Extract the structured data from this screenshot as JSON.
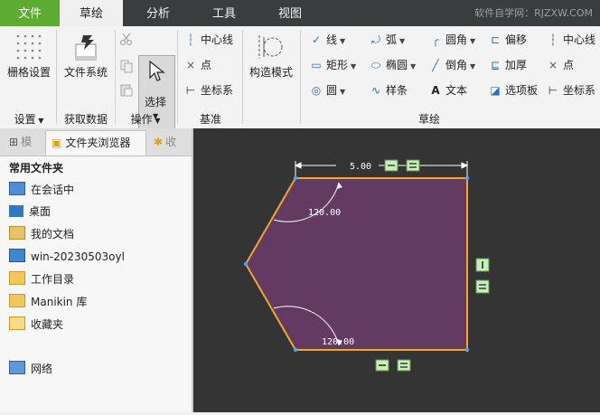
{
  "tabs": [
    "文件",
    "草绘",
    "分析",
    "工具",
    "视图"
  ],
  "watermark": "软件自学网：RJZXW.COM",
  "ribbon": {
    "grid_settings": "栅格设置",
    "settings_group": "设置",
    "file_system": "文件系统",
    "get_data_group": "获取数据",
    "select": "选择",
    "operations_group": "操作",
    "datum": {
      "centerline": "中心线",
      "point": "点",
      "coord": "坐标系",
      "group": "基准"
    },
    "construct_mode": "构造模式",
    "sketch": {
      "line": "线",
      "rect": "矩形",
      "circle": "圆",
      "arc": "弧",
      "ellipse": "椭圆",
      "spline": "样条",
      "fillet": "圆角",
      "chamfer": "倒角",
      "text": "文本",
      "offset": "偏移",
      "thicken": "加厚",
      "palette": "选项板",
      "centerline": "中心线",
      "point": "点",
      "coord": "坐标系",
      "group": "草绘"
    }
  },
  "panel": {
    "tabs": [
      "模",
      "文件夹浏览器",
      "收"
    ],
    "section": "常用文件夹",
    "items": [
      "在会话中",
      "桌面",
      "我的文档",
      "win-20230503oyl",
      "工作目录",
      "Manikin 库",
      "收藏夹",
      "网络"
    ]
  },
  "sketch": {
    "dim_length": "5.00",
    "angle_top": "120.00",
    "angle_bottom": "120.00",
    "fill_color": "#633a62",
    "edge_color": "#f2a62b"
  }
}
